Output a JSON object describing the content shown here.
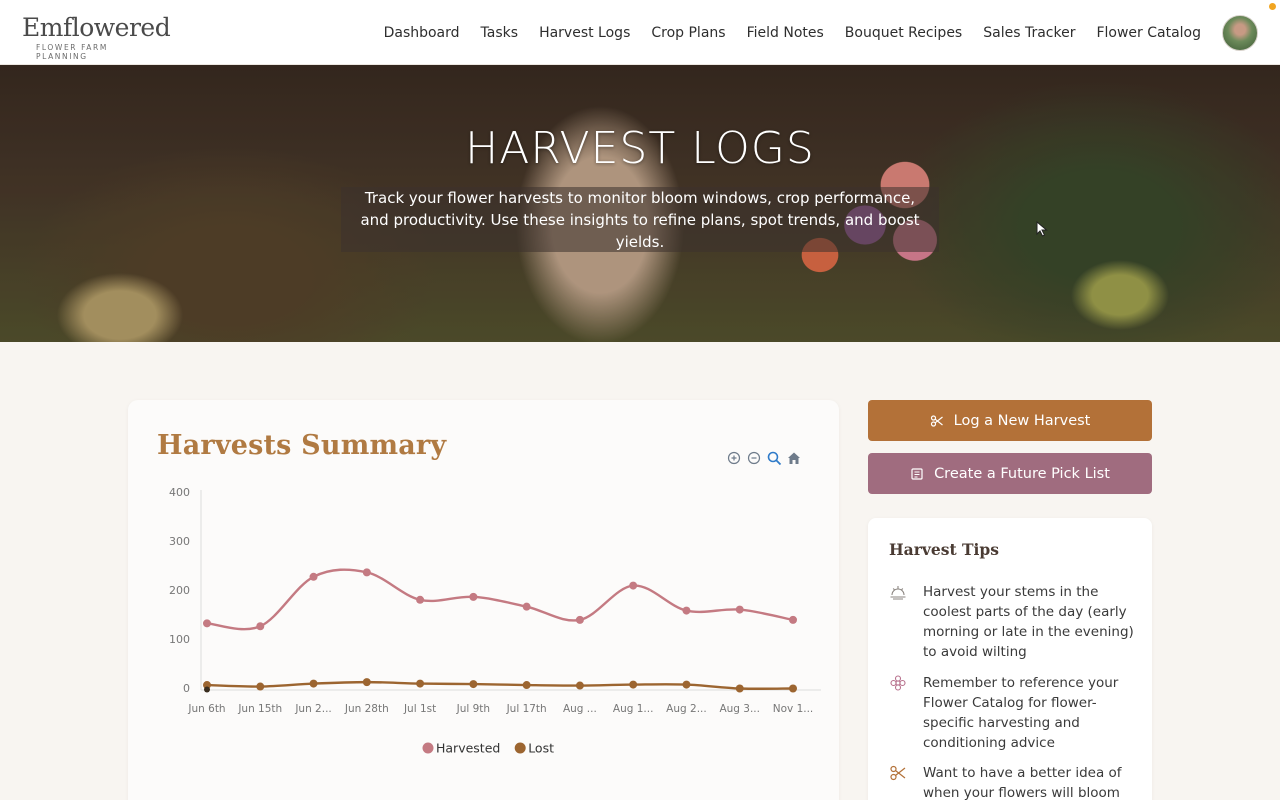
{
  "brand": {
    "name": "Emflowered",
    "tagline": "FLOWER FARM PLANNING"
  },
  "nav": [
    {
      "label": "Dashboard"
    },
    {
      "label": "Tasks"
    },
    {
      "label": "Harvest Logs"
    },
    {
      "label": "Crop Plans"
    },
    {
      "label": "Field Notes"
    },
    {
      "label": "Bouquet Recipes"
    },
    {
      "label": "Sales Tracker"
    },
    {
      "label": "Flower Catalog"
    }
  ],
  "hero": {
    "title": "HARVEST LOGS",
    "description": "Track your flower harvests to monitor bloom windows, crop performance, and productivity. Use these insights to refine plans, spot trends, and boost yields."
  },
  "summary": {
    "title": "Harvests Summary",
    "tools": [
      "zoom-in-icon",
      "zoom-out-icon",
      "magnify-icon",
      "home-icon"
    ]
  },
  "chart_data": {
    "type": "line",
    "categories": [
      "Jun 6th",
      "Jun 15th",
      "Jun 2...",
      "Jun 28th",
      "Jul 1st",
      "Jul 9th",
      "Jul 17th",
      "Aug ...",
      "Aug 1...",
      "Aug 2...",
      "Aug 3...",
      "Nov 1..."
    ],
    "series": [
      {
        "name": "Harvested",
        "color": "#c47a82",
        "values": [
          132,
          126,
          227,
          236,
          180,
          186,
          166,
          139,
          209,
          158,
          160,
          139
        ]
      },
      {
        "name": "Lost",
        "color": "#9c6530",
        "values": [
          6,
          3,
          9,
          12,
          9,
          8,
          6,
          5,
          7,
          7,
          -1,
          -1
        ]
      }
    ],
    "yticks": [
      0,
      100,
      200,
      300,
      400
    ],
    "ylim": [
      0,
      400
    ],
    "title": "",
    "xlabel": "",
    "ylabel": "",
    "legend": "bottom-center",
    "grid": false
  },
  "actions": {
    "log_harvest": "Log a New Harvest",
    "pick_list": "Create a Future Pick List"
  },
  "tips": {
    "title": "Harvest Tips",
    "items": [
      {
        "icon": "sunrise-icon",
        "text": "Harvest your stems in the coolest parts of the day (early morning or late in the evening) to avoid wilting"
      },
      {
        "icon": "flower-icon",
        "text": "Remember to reference your Flower Catalog for flower-specific harvesting and conditioning advice"
      },
      {
        "icon": "scissors-icon",
        "text": "Want to have a better idea of when your flowers will bloom"
      }
    ]
  },
  "colors": {
    "accent": "#b37138",
    "secondary": "#a06c7f",
    "title": "#b07a42"
  }
}
